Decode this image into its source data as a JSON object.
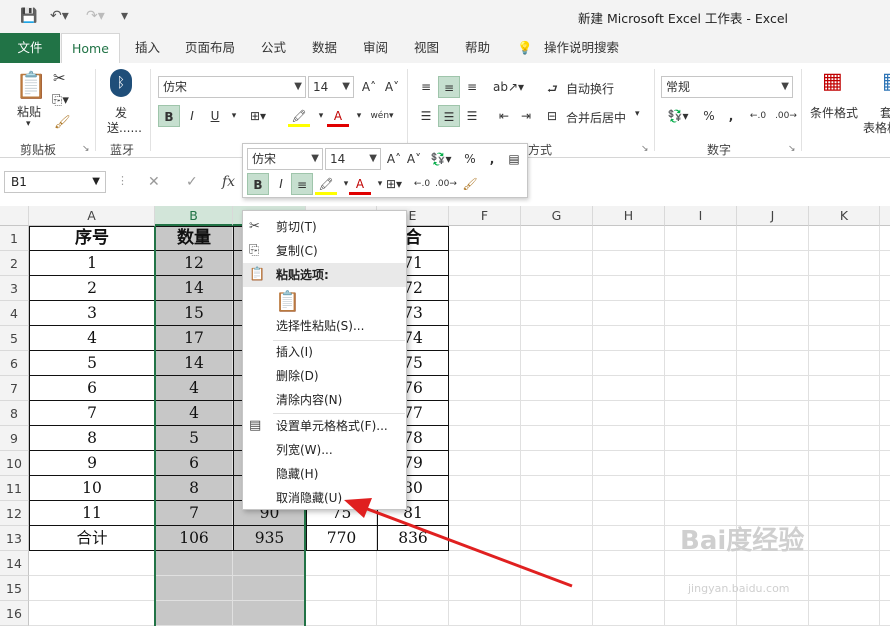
{
  "titlebar": {
    "title": "新建 Microsoft Excel 工作表  -  Excel"
  },
  "tabs": {
    "file": "文件",
    "items": [
      "Home",
      "插入",
      "页面布局",
      "公式",
      "数据",
      "审阅",
      "视图",
      "帮助"
    ],
    "tellme": "操作说明搜索"
  },
  "ribbon": {
    "paste": "粘贴",
    "send": "发",
    "send2": "送......",
    "font_name": "仿宋",
    "font_size": "14",
    "number_format": "常规",
    "wrap_text": "自动换行",
    "merge_center": "合并后居中",
    "cond_format": "条件格式",
    "table_format_1": "套",
    "table_format_2": "表格格",
    "groups": {
      "clipboard": "剪贴板",
      "bluetooth": "蓝牙",
      "alignment": "方式",
      "number": "数字"
    }
  },
  "formula_bar": {
    "name_box": "B1",
    "fx": "fx"
  },
  "columns": [
    "A",
    "B",
    "C",
    "D",
    "E",
    "F",
    "G",
    "H",
    "I",
    "J",
    "K",
    "L"
  ],
  "rows": [
    "1",
    "2",
    "3",
    "4",
    "5",
    "6",
    "7",
    "8",
    "9",
    "10",
    "11",
    "12",
    "13",
    "14",
    "15",
    "16"
  ],
  "sheet": {
    "A": [
      "序号",
      "1",
      "2",
      "3",
      "4",
      "5",
      "6",
      "7",
      "8",
      "9",
      "10",
      "11",
      "合计"
    ],
    "B": [
      "数量",
      "12",
      "14",
      "15",
      "17",
      "14",
      "4",
      "4",
      "5",
      "6",
      "8",
      "7",
      "106"
    ],
    "C12": "90",
    "C13": "935",
    "D12": "75",
    "D13": "770",
    "E": [
      "合",
      "71",
      "72",
      "73",
      "74",
      "75",
      "76",
      "77",
      "78",
      "79",
      "80",
      "81",
      "836"
    ]
  },
  "mini_toolbar": {
    "font_name": "仿宋",
    "font_size": "14"
  },
  "context_menu": {
    "cut": "剪切(T)",
    "copy": "复制(C)",
    "paste_options": "粘贴选项:",
    "paste_special": "选择性粘贴(S)...",
    "insert": "插入(I)",
    "delete": "删除(D)",
    "clear": "清除内容(N)",
    "format_cells": "设置单元格格式(F)...",
    "column_width": "列宽(W)...",
    "hide": "隐藏(H)",
    "unhide": "取消隐藏(U)"
  },
  "watermark": {
    "line1": "Bai度经验",
    "line2": "jingyan.baidu.com"
  },
  "colors": {
    "excel_green": "#217346",
    "selection": "#c7c7c7",
    "arrow": "#e02020"
  }
}
